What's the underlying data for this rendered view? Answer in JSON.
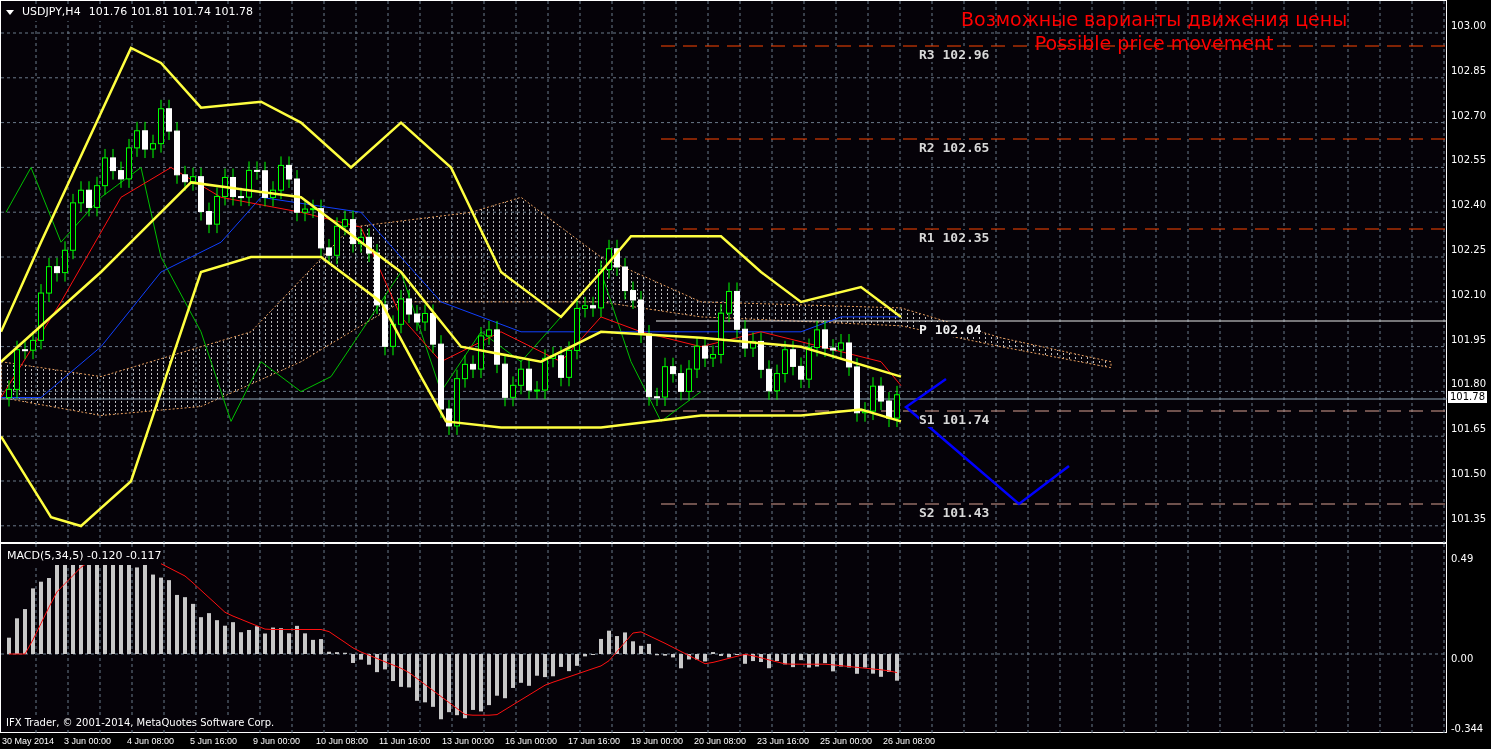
{
  "chart": {
    "symbol": "USDJPY,H4",
    "ohlc": "101.76 101.81 101.74 101.78"
  },
  "annotation": {
    "title": "Возможные варианты движения цены",
    "subtitle": "Possible price movement"
  },
  "pivot_levels": [
    {
      "label": "R3 102.96",
      "kind": "resistance"
    },
    {
      "label": "R2 102.65",
      "kind": "resistance"
    },
    {
      "label": "R1 102.35",
      "kind": "resistance"
    },
    {
      "label": "P 102.04",
      "kind": "pivot"
    },
    {
      "label": "S1 101.74",
      "kind": "support"
    },
    {
      "label": "S2 101.43",
      "kind": "support"
    }
  ],
  "price_axis": [
    "103.00",
    "102.85",
    "102.70",
    "102.55",
    "102.40",
    "102.25",
    "102.10",
    "101.95",
    "101.80",
    "101.65",
    "101.50",
    "101.35"
  ],
  "current_price": "101.78",
  "indicator": {
    "label": "MACD(5,34,5) -0.120 -0.117",
    "axis": [
      "0.49",
      "0.00",
      "-0.344"
    ]
  },
  "copyright": "IFX Trader, © 2001-2014, MetaQuotes Software Corp.",
  "time_axis": [
    "30 May 2014",
    "3 Jun 00:00",
    "4 Jun 08:00",
    "5 Jun 16:00",
    "9 Jun 00:00",
    "10 Jun 08:00",
    "11 Jun 16:00",
    "13 Jun 00:00",
    "16 Jun 00:00",
    "17 Jun 16:00",
    "19 Jun 00:00",
    "20 Jun 08:00",
    "23 Jun 16:00",
    "25 Jun 00:00",
    "26 Jun 08:00"
  ]
}
